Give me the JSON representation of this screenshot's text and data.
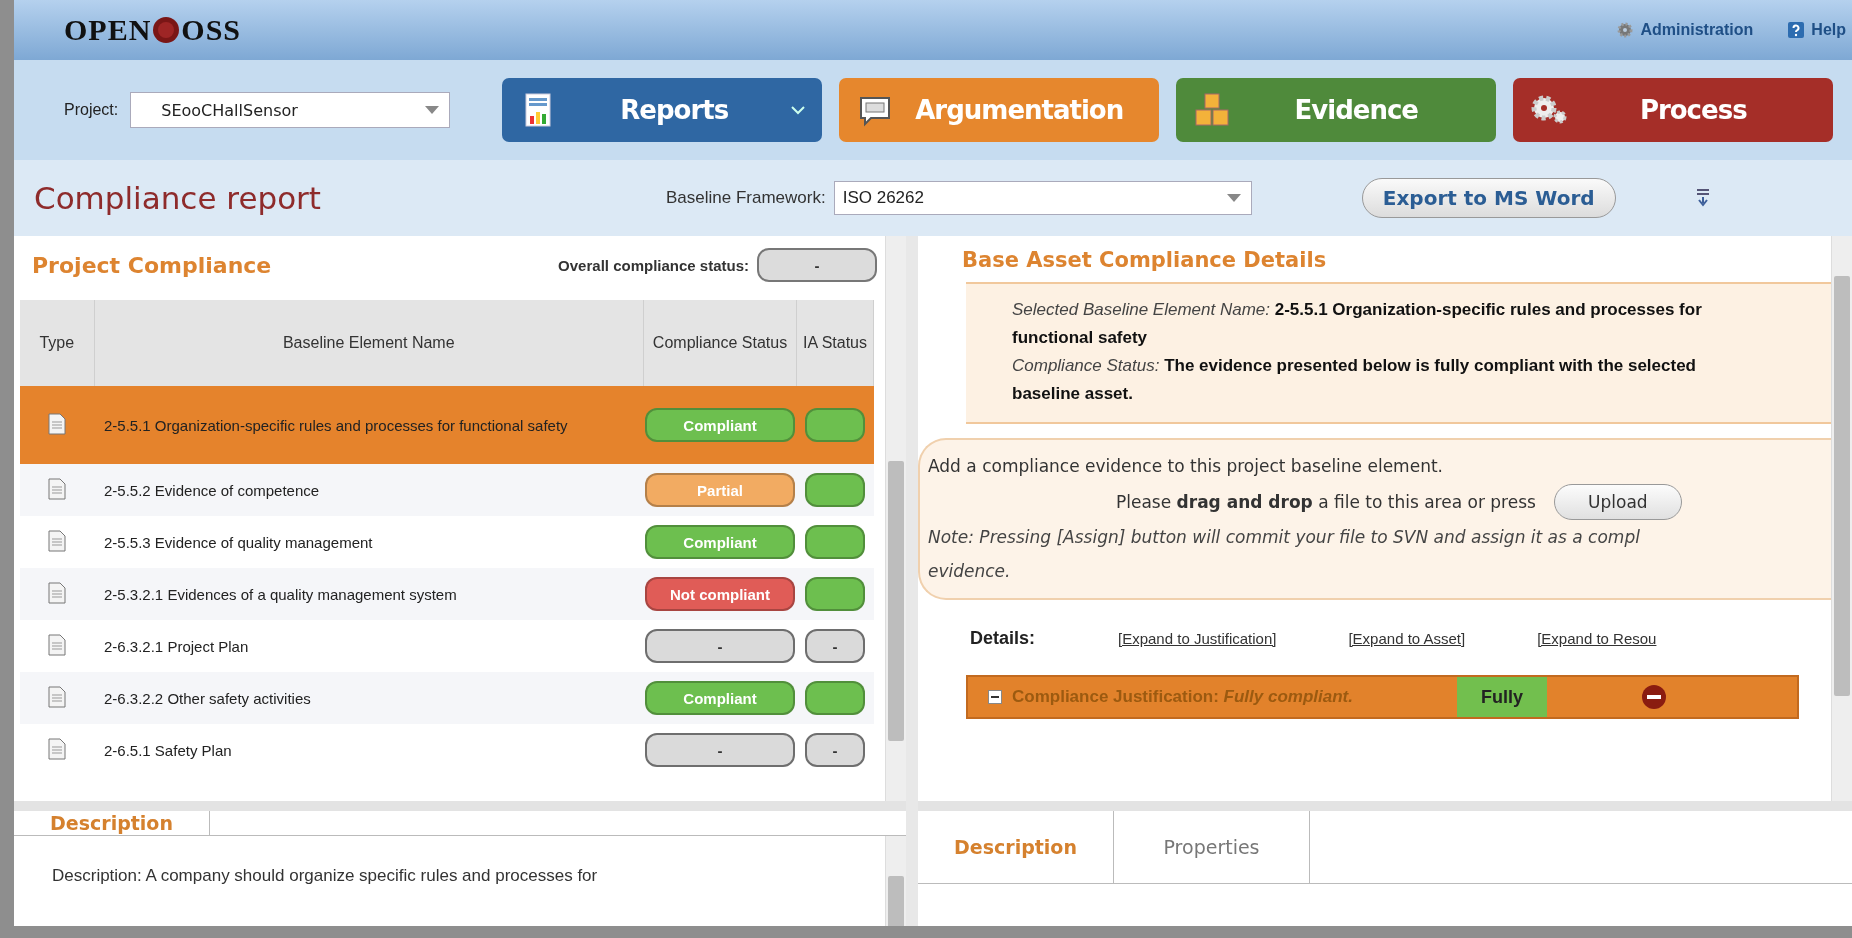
{
  "logo": {
    "before": "OPEN",
    "after": "OSS"
  },
  "top_links": [
    {
      "kind": "admin",
      "label": "Administration"
    },
    {
      "kind": "help",
      "label": "Help"
    }
  ],
  "project": {
    "label": "Project:",
    "value": "SEooCHallSensor"
  },
  "nav": [
    {
      "kind": "reports",
      "label": "Reports",
      "dropdown": true
    },
    {
      "kind": "argumentation",
      "label": "Argumentation",
      "dropdown": false
    },
    {
      "kind": "evidence",
      "label": "Evidence",
      "dropdown": false
    },
    {
      "kind": "process",
      "label": "Process",
      "dropdown": false
    }
  ],
  "page_title": "Compliance report",
  "baseline": {
    "label": "Baseline Framework:",
    "value": "ISO 26262"
  },
  "export_button": "Export to MS Word",
  "project_compliance": {
    "title": "Project Compliance",
    "overall_label": "Overall compliance status:",
    "overall_value": "-",
    "table": {
      "columns": [
        "Type",
        "Baseline Element Name",
        "Compliance Status",
        "IA Status"
      ],
      "rows": [
        {
          "name": "2-5.5.1 Organization-specific rules and processes for functional safety",
          "selected": true,
          "compliance": {
            "color": "#6dbf4f",
            "text": "Compliant"
          },
          "ia": {
            "color": "#6dbf4f"
          }
        },
        {
          "name": "2-5.5.2 Evidence of competence",
          "selected": false,
          "compliance": {
            "color": "#f2ab62",
            "text": "Partial"
          },
          "ia": {
            "color": "#6dbf4f"
          }
        },
        {
          "name": "2-5.5.3 Evidence of quality management",
          "selected": false,
          "compliance": {
            "color": "#6dbf4f",
            "text": "Compliant"
          },
          "ia": {
            "color": "#6dbf4f"
          }
        },
        {
          "name": "2-5.3.2.1 Evidences of a quality management system",
          "selected": false,
          "compliance": {
            "color": "#e05c57",
            "text": "Not compliant"
          },
          "ia": {
            "color": "#6dbf4f"
          }
        },
        {
          "name": "2-6.3.2.1 Project Plan",
          "selected": false,
          "compliance": {
            "color": "#dadada",
            "text": "-"
          },
          "ia": {
            "color": "#dadada",
            "text": "-"
          }
        },
        {
          "name": "2-6.3.2.2 Other safety activities",
          "selected": false,
          "compliance": {
            "color": "#6dbf4f",
            "text": "Compliant"
          },
          "ia": {
            "color": "#6dbf4f"
          }
        },
        {
          "name": "2-6.5.1 Safety Plan",
          "selected": false,
          "compliance": {
            "color": "#dadada",
            "text": "-"
          },
          "ia": {
            "color": "#dadada",
            "text": "-"
          }
        }
      ]
    }
  },
  "left_tabs": [
    {
      "label": "Description",
      "selected": true
    }
  ],
  "description_text": "Description: A company should organize specific rules and processes for",
  "details": {
    "title": "Base Asset Compliance Details",
    "info": [
      {
        "label": "Selected Baseline Element Name:",
        "value": "2-5.5.1 Organization-specific rules and processes for functional safety"
      },
      {
        "label": "Compliance Status:",
        "value": "The evidence presented below is fully compliant with the selected baseline asset."
      }
    ],
    "evidence_intro": "Add a compliance evidence to this project baseline element.",
    "drop_text": "Please **drag and drop** a file to this area or press",
    "upload_button": "Upload",
    "note_lines": [
      "Note: Pressing [Assign] button will commit your file to SVN and assign it as a compl",
      "evidence."
    ],
    "details_label": "Details:",
    "expand_links": [
      "[Expand to Justification]",
      "[Expand to Asset]",
      "[Expand to Resou"
    ],
    "justification": {
      "expanded": true,
      "text": "Compliance Justification: *Fully compliant.*",
      "level_label": "Fully"
    }
  },
  "right_tabs": [
    {
      "label": "Description",
      "selected": true
    },
    {
      "label": "Properties",
      "selected": false
    }
  ]
}
